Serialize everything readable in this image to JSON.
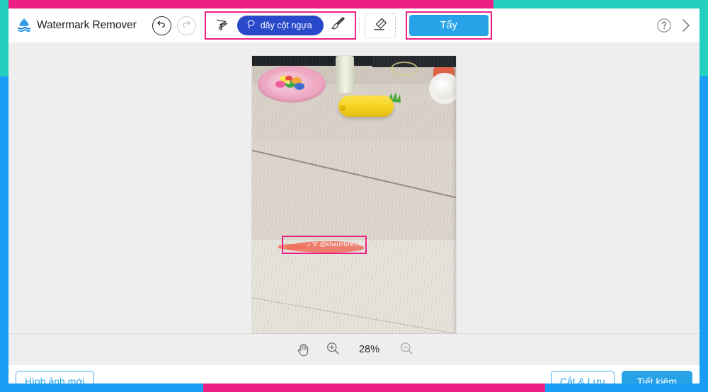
{
  "app": {
    "brand_name": "Watermark Remover",
    "logo_icon": "water-drop-waves-logo"
  },
  "toolbar": {
    "undo_icon": "undo-arrow-icon",
    "redo_icon": "redo-arrow-icon",
    "lasso_tool_icon": "polygon-lasso-icon",
    "selection_pill_label": "dây cột ngựa",
    "selection_pill_icon": "lasso-icon",
    "brush_icon": "paintbrush-icon",
    "eraser_icon": "eraser-icon",
    "erase_button_label": "Tẩy",
    "help_icon": "question-mark-circle-icon",
    "next_icon": "chevron-right-icon"
  },
  "canvas": {
    "watermark_text": "@khanhhhinnn",
    "watermark_brand_icon": "tiktok-note-icon",
    "selection_color": "#ec2084"
  },
  "zoom_bar": {
    "pan_icon": "hand-pan-icon",
    "zoom_in_icon": "magnifier-plus-icon",
    "zoom_level": "28%",
    "zoom_out_icon": "magnifier-minus-icon"
  },
  "footer": {
    "new_image_label": "Hình ảnh mới",
    "crop_save_label": "Cắt & Lưu",
    "save_label": "Tiết kiệm"
  },
  "colors": {
    "accent_blue": "#29a3e8",
    "pill_blue": "#2849c9",
    "highlight_pink": "#ec2084",
    "frame_teal": "#23cfc0",
    "frame_blue": "#1a9ef5"
  }
}
